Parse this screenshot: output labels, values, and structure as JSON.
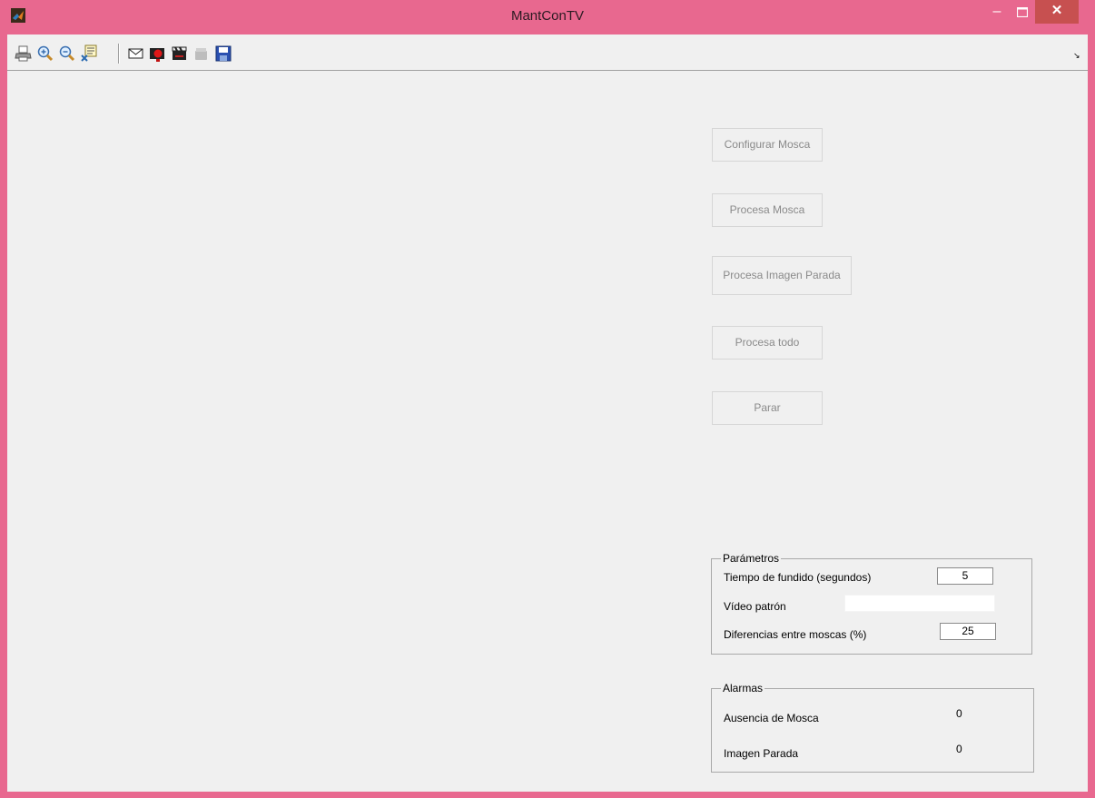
{
  "window": {
    "title": "MantConTV",
    "controls": {
      "minimize": "–",
      "maximize": "□",
      "close": "✕"
    }
  },
  "toolbar": {
    "icons": [
      "print-icon",
      "zoom-in-icon",
      "zoom-out-icon",
      "data-cursor-icon",
      "mail-icon",
      "record-icon",
      "clapperboard-icon",
      "clear-icon",
      "save-icon"
    ],
    "overflow": "↘"
  },
  "buttons": {
    "configurar": "Configurar Mosca",
    "procesa_mosca": "Procesa Mosca",
    "procesa_imagen": "Procesa Imagen Parada",
    "procesa_todo": "Procesa todo",
    "parar": "Parar"
  },
  "parametros": {
    "title": "Parámetros",
    "tiempo_label": "Tiempo de fundido (segundos)",
    "tiempo_value": "5",
    "video_label": "Vídeo patrón",
    "video_value": "",
    "diferencias_label": "Diferencias entre moscas (%)",
    "diferencias_value": "25"
  },
  "alarmas": {
    "title": "Alarmas",
    "ausencia_label": "Ausencia de Mosca",
    "ausencia_value": "0",
    "imagen_label": "Imagen Parada",
    "imagen_value": "0"
  },
  "colors": {
    "frame": "#e8688f",
    "close_button": "#c75050",
    "client_bg": "#f0f0f0"
  }
}
